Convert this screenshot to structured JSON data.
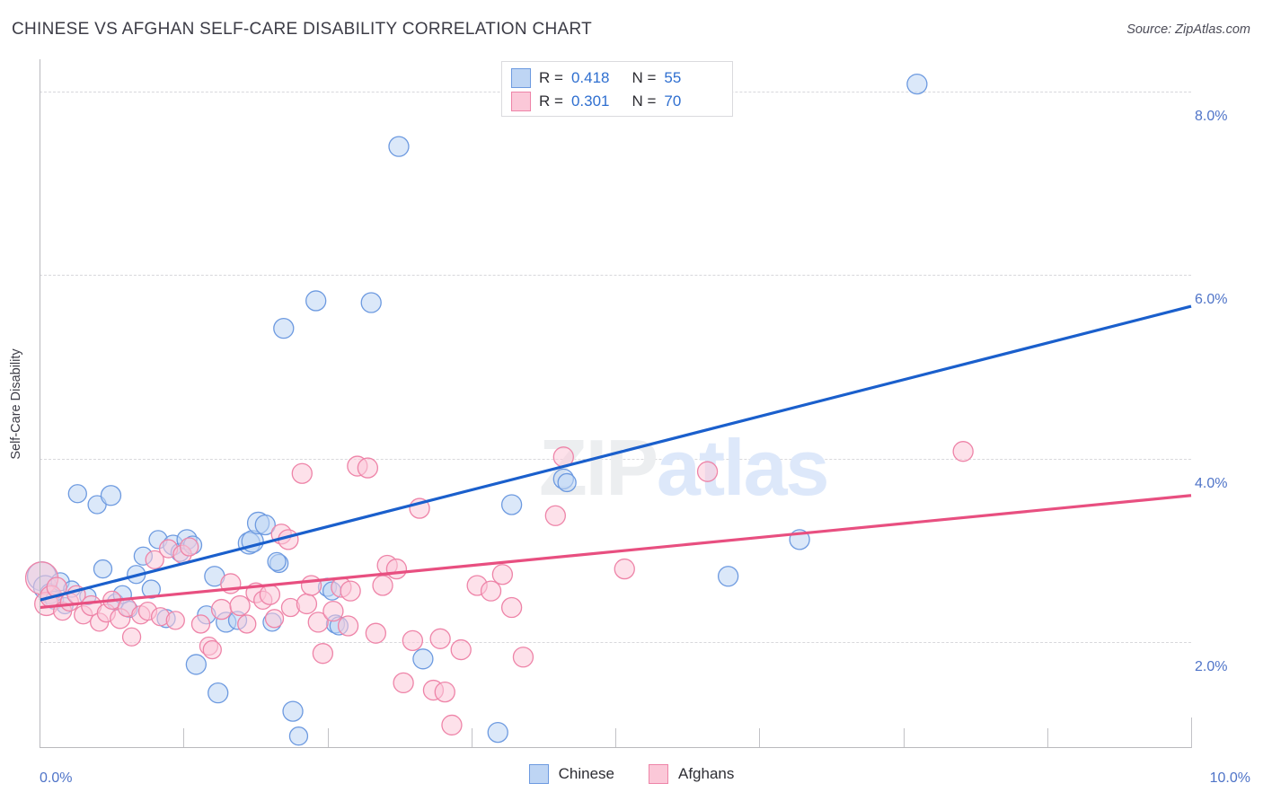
{
  "header": {
    "title": "CHINESE VS AFGHAN SELF-CARE DISABILITY CORRELATION CHART",
    "source": "Source: ZipAtlas.com"
  },
  "watermark": {
    "part1": "ZIP",
    "part2": "atlas"
  },
  "stats_legend": {
    "rows": [
      {
        "series": "Chinese",
        "r_label": "R =",
        "r_value": "0.418",
        "n_label": "N =",
        "n_value": "55",
        "color": "#bed5f4"
      },
      {
        "series": "Afghans",
        "r_label": "R =",
        "r_value": "0.301",
        "n_label": "N =",
        "n_value": "70",
        "color": "#fbc8d8"
      }
    ]
  },
  "bottom_legend": {
    "items": [
      {
        "label": "Chinese",
        "color": "#bed5f4"
      },
      {
        "label": "Afghans",
        "color": "#fbc8d8"
      }
    ]
  },
  "chart_data": {
    "type": "scatter",
    "title": "CHINESE VS AFGHAN SELF-CARE DISABILITY CORRELATION CHART",
    "xlabel": "",
    "ylabel": "Self-Care Disability",
    "xlim": [
      0.0,
      10.0
    ],
    "ylim": [
      0.85,
      8.35
    ],
    "x_unit": "%",
    "y_unit": "%",
    "grid": true,
    "legend_position": "bottom-center",
    "xticks": [
      {
        "value": 0.0,
        "label": "0.0%",
        "major": true
      },
      {
        "value": 1.25,
        "label": "",
        "major": false
      },
      {
        "value": 2.5,
        "label": "",
        "major": false
      },
      {
        "value": 3.75,
        "label": "",
        "major": false
      },
      {
        "value": 5.0,
        "label": "",
        "major": false
      },
      {
        "value": 6.25,
        "label": "",
        "major": false
      },
      {
        "value": 7.5,
        "label": "",
        "major": false
      },
      {
        "value": 8.75,
        "label": "",
        "major": false
      },
      {
        "value": 10.0,
        "label": "10.0%",
        "major": true
      }
    ],
    "yticks": [
      {
        "value": 8.0,
        "label": "8.0%"
      },
      {
        "value": 6.0,
        "label": "6.0%"
      },
      {
        "value": 4.0,
        "label": "4.0%"
      },
      {
        "value": 2.0,
        "label": "2.0%"
      }
    ],
    "series": [
      {
        "name": "Chinese",
        "color": "#bed5f4",
        "edge_color": "#6d9ae0",
        "r": 0.418,
        "n": 55,
        "trendline": {
          "x0": 0.0,
          "y0": 2.46,
          "x1": 10.0,
          "y1": 5.66,
          "color": "#1a5fcc"
        },
        "points": [
          {
            "x": 0.02,
            "y": 2.72,
            "r": 16
          },
          {
            "x": 0.05,
            "y": 2.6,
            "r": 13
          },
          {
            "x": 0.09,
            "y": 2.53,
            "r": 11
          },
          {
            "x": 0.13,
            "y": 2.46,
            "r": 10
          },
          {
            "x": 0.18,
            "y": 2.66,
            "r": 10
          },
          {
            "x": 0.22,
            "y": 2.4,
            "r": 9
          },
          {
            "x": 0.28,
            "y": 2.58,
            "r": 9
          },
          {
            "x": 0.33,
            "y": 3.62,
            "r": 10
          },
          {
            "x": 0.42,
            "y": 2.5,
            "r": 9
          },
          {
            "x": 0.5,
            "y": 3.5,
            "r": 10
          },
          {
            "x": 0.55,
            "y": 2.8,
            "r": 10
          },
          {
            "x": 0.62,
            "y": 3.6,
            "r": 11
          },
          {
            "x": 0.66,
            "y": 2.44,
            "r": 9
          },
          {
            "x": 0.72,
            "y": 2.52,
            "r": 10
          },
          {
            "x": 0.78,
            "y": 2.36,
            "r": 9
          },
          {
            "x": 0.84,
            "y": 2.74,
            "r": 10
          },
          {
            "x": 0.9,
            "y": 2.94,
            "r": 10
          },
          {
            "x": 0.97,
            "y": 2.58,
            "r": 10
          },
          {
            "x": 1.03,
            "y": 3.12,
            "r": 10
          },
          {
            "x": 1.1,
            "y": 2.26,
            "r": 10
          },
          {
            "x": 1.16,
            "y": 3.06,
            "r": 11
          },
          {
            "x": 1.22,
            "y": 2.98,
            "r": 10
          },
          {
            "x": 1.28,
            "y": 3.12,
            "r": 11
          },
          {
            "x": 1.33,
            "y": 3.06,
            "r": 10
          },
          {
            "x": 1.36,
            "y": 1.76,
            "r": 11
          },
          {
            "x": 1.45,
            "y": 2.3,
            "r": 10
          },
          {
            "x": 1.52,
            "y": 2.72,
            "r": 11
          },
          {
            "x": 1.55,
            "y": 1.45,
            "r": 11
          },
          {
            "x": 1.62,
            "y": 2.22,
            "r": 11
          },
          {
            "x": 1.72,
            "y": 2.24,
            "r": 10
          },
          {
            "x": 1.82,
            "y": 3.08,
            "r": 12
          },
          {
            "x": 1.85,
            "y": 3.1,
            "r": 12
          },
          {
            "x": 1.9,
            "y": 3.3,
            "r": 12
          },
          {
            "x": 1.96,
            "y": 3.28,
            "r": 11
          },
          {
            "x": 2.02,
            "y": 2.22,
            "r": 10
          },
          {
            "x": 2.08,
            "y": 2.86,
            "r": 10
          },
          {
            "x": 2.12,
            "y": 5.42,
            "r": 11
          },
          {
            "x": 2.2,
            "y": 1.25,
            "r": 11
          },
          {
            "x": 2.25,
            "y": 0.98,
            "r": 10
          },
          {
            "x": 2.4,
            "y": 5.72,
            "r": 11
          },
          {
            "x": 2.5,
            "y": 2.6,
            "r": 10
          },
          {
            "x": 2.54,
            "y": 2.56,
            "r": 10
          },
          {
            "x": 2.57,
            "y": 2.2,
            "r": 10
          },
          {
            "x": 2.6,
            "y": 2.18,
            "r": 10
          },
          {
            "x": 2.88,
            "y": 5.7,
            "r": 11
          },
          {
            "x": 3.12,
            "y": 7.4,
            "r": 11
          },
          {
            "x": 3.33,
            "y": 1.82,
            "r": 11
          },
          {
            "x": 3.98,
            "y": 1.02,
            "r": 11
          },
          {
            "x": 4.1,
            "y": 3.5,
            "r": 11
          },
          {
            "x": 4.55,
            "y": 3.78,
            "r": 11
          },
          {
            "x": 4.58,
            "y": 3.74,
            "r": 10
          },
          {
            "x": 5.98,
            "y": 2.72,
            "r": 11
          },
          {
            "x": 6.6,
            "y": 3.12,
            "r": 11
          },
          {
            "x": 7.62,
            "y": 8.08,
            "r": 11
          },
          {
            "x": 2.06,
            "y": 2.88,
            "r": 10
          }
        ]
      },
      {
        "name": "Afghans",
        "color": "#fbc8d8",
        "edge_color": "#ee84a8",
        "r": 0.301,
        "n": 70,
        "trendline": {
          "x0": 0.0,
          "y0": 2.38,
          "x1": 10.0,
          "y1": 3.6,
          "color": "#e84f80"
        },
        "points": [
          {
            "x": 0.02,
            "y": 2.7,
            "r": 18
          },
          {
            "x": 0.06,
            "y": 2.42,
            "r": 13
          },
          {
            "x": 0.1,
            "y": 2.5,
            "r": 12
          },
          {
            "x": 0.15,
            "y": 2.6,
            "r": 11
          },
          {
            "x": 0.2,
            "y": 2.34,
            "r": 10
          },
          {
            "x": 0.26,
            "y": 2.44,
            "r": 10
          },
          {
            "x": 0.32,
            "y": 2.52,
            "r": 10
          },
          {
            "x": 0.38,
            "y": 2.3,
            "r": 10
          },
          {
            "x": 0.45,
            "y": 2.4,
            "r": 11
          },
          {
            "x": 0.52,
            "y": 2.22,
            "r": 10
          },
          {
            "x": 0.58,
            "y": 2.32,
            "r": 10
          },
          {
            "x": 0.63,
            "y": 2.46,
            "r": 10
          },
          {
            "x": 0.7,
            "y": 2.26,
            "r": 11
          },
          {
            "x": 0.76,
            "y": 2.38,
            "r": 10
          },
          {
            "x": 0.8,
            "y": 2.06,
            "r": 10
          },
          {
            "x": 0.88,
            "y": 2.3,
            "r": 10
          },
          {
            "x": 0.94,
            "y": 2.34,
            "r": 10
          },
          {
            "x": 1.0,
            "y": 2.9,
            "r": 10
          },
          {
            "x": 1.05,
            "y": 2.28,
            "r": 10
          },
          {
            "x": 1.12,
            "y": 3.02,
            "r": 10
          },
          {
            "x": 1.18,
            "y": 2.24,
            "r": 10
          },
          {
            "x": 1.24,
            "y": 2.96,
            "r": 10
          },
          {
            "x": 1.3,
            "y": 3.04,
            "r": 10
          },
          {
            "x": 1.4,
            "y": 2.2,
            "r": 10
          },
          {
            "x": 1.47,
            "y": 1.96,
            "r": 10
          },
          {
            "x": 1.5,
            "y": 1.92,
            "r": 10
          },
          {
            "x": 1.58,
            "y": 2.36,
            "r": 11
          },
          {
            "x": 1.66,
            "y": 2.64,
            "r": 11
          },
          {
            "x": 1.74,
            "y": 2.4,
            "r": 11
          },
          {
            "x": 1.8,
            "y": 2.2,
            "r": 10
          },
          {
            "x": 1.88,
            "y": 2.54,
            "r": 11
          },
          {
            "x": 1.94,
            "y": 2.46,
            "r": 10
          },
          {
            "x": 2.0,
            "y": 2.52,
            "r": 11
          },
          {
            "x": 2.04,
            "y": 2.26,
            "r": 10
          },
          {
            "x": 2.1,
            "y": 3.18,
            "r": 11
          },
          {
            "x": 2.16,
            "y": 3.12,
            "r": 11
          },
          {
            "x": 2.18,
            "y": 2.38,
            "r": 10
          },
          {
            "x": 2.28,
            "y": 3.84,
            "r": 11
          },
          {
            "x": 2.32,
            "y": 2.42,
            "r": 11
          },
          {
            "x": 2.36,
            "y": 2.62,
            "r": 11
          },
          {
            "x": 2.42,
            "y": 2.22,
            "r": 11
          },
          {
            "x": 2.46,
            "y": 1.88,
            "r": 11
          },
          {
            "x": 2.55,
            "y": 2.34,
            "r": 11
          },
          {
            "x": 2.62,
            "y": 2.6,
            "r": 11
          },
          {
            "x": 2.68,
            "y": 2.18,
            "r": 11
          },
          {
            "x": 2.7,
            "y": 2.56,
            "r": 11
          },
          {
            "x": 2.76,
            "y": 3.92,
            "r": 11
          },
          {
            "x": 2.85,
            "y": 3.9,
            "r": 11
          },
          {
            "x": 2.92,
            "y": 2.1,
            "r": 11
          },
          {
            "x": 2.98,
            "y": 2.62,
            "r": 11
          },
          {
            "x": 3.02,
            "y": 2.84,
            "r": 11
          },
          {
            "x": 3.1,
            "y": 2.8,
            "r": 11
          },
          {
            "x": 3.16,
            "y": 1.56,
            "r": 11
          },
          {
            "x": 3.24,
            "y": 2.02,
            "r": 11
          },
          {
            "x": 3.3,
            "y": 3.46,
            "r": 11
          },
          {
            "x": 3.42,
            "y": 1.48,
            "r": 11
          },
          {
            "x": 3.48,
            "y": 2.04,
            "r": 11
          },
          {
            "x": 3.52,
            "y": 1.46,
            "r": 11
          },
          {
            "x": 3.58,
            "y": 1.1,
            "r": 11
          },
          {
            "x": 3.66,
            "y": 1.92,
            "r": 11
          },
          {
            "x": 3.8,
            "y": 2.62,
            "r": 11
          },
          {
            "x": 3.92,
            "y": 2.56,
            "r": 11
          },
          {
            "x": 4.02,
            "y": 2.74,
            "r": 11
          },
          {
            "x": 4.1,
            "y": 2.38,
            "r": 11
          },
          {
            "x": 4.2,
            "y": 1.84,
            "r": 11
          },
          {
            "x": 4.48,
            "y": 3.38,
            "r": 11
          },
          {
            "x": 4.55,
            "y": 4.02,
            "r": 11
          },
          {
            "x": 5.08,
            "y": 2.8,
            "r": 11
          },
          {
            "x": 5.8,
            "y": 3.86,
            "r": 11
          },
          {
            "x": 8.02,
            "y": 4.08,
            "r": 11
          }
        ]
      }
    ]
  }
}
